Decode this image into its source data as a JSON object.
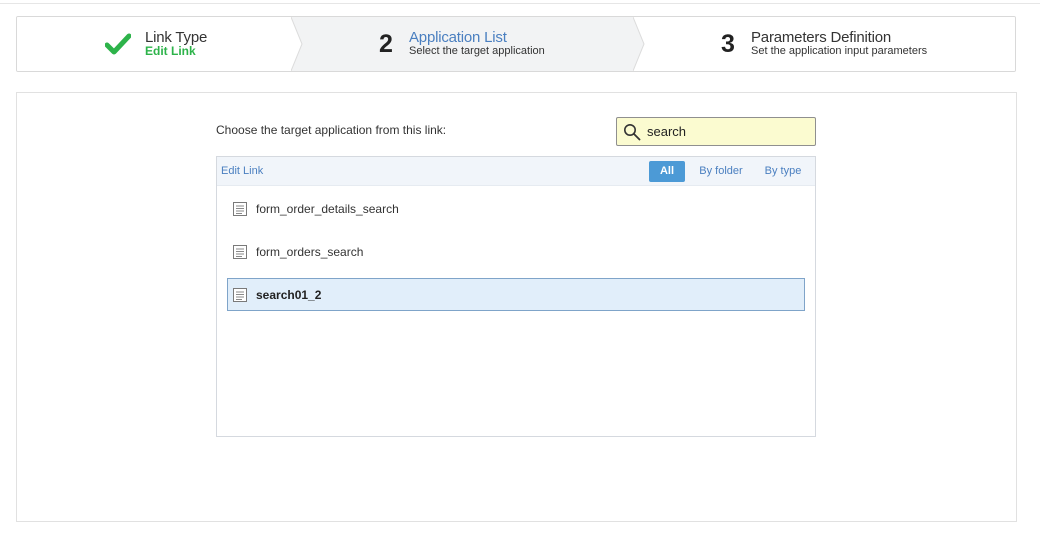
{
  "wizard": {
    "steps": [
      {
        "number": "",
        "title": "Link Type",
        "subtitle": "Edit Link",
        "state": "done"
      },
      {
        "number": "2",
        "title": "Application List",
        "subtitle": "Select the target application",
        "state": "active"
      },
      {
        "number": "3",
        "title": "Parameters Definition",
        "subtitle": "Set the application input parameters",
        "state": "pending"
      }
    ]
  },
  "main": {
    "choose_label": "Choose the target application from this link:",
    "search": {
      "value": "search",
      "placeholder": ""
    },
    "list": {
      "breadcrumb": "Edit Link",
      "filters": {
        "all": "All",
        "by_folder": "By folder",
        "by_type": "By type",
        "selected": "All"
      },
      "items": [
        {
          "label": "form_order_details_search",
          "selected": false
        },
        {
          "label": "form_orders_search",
          "selected": false
        },
        {
          "label": "search01_2",
          "selected": true
        }
      ]
    }
  },
  "colors": {
    "accent": "#4a7fc0",
    "done_green": "#2db34a",
    "search_bg": "#fbfbd0",
    "selected_bg": "#e1eefa",
    "filter_active": "#4c9ad6"
  }
}
